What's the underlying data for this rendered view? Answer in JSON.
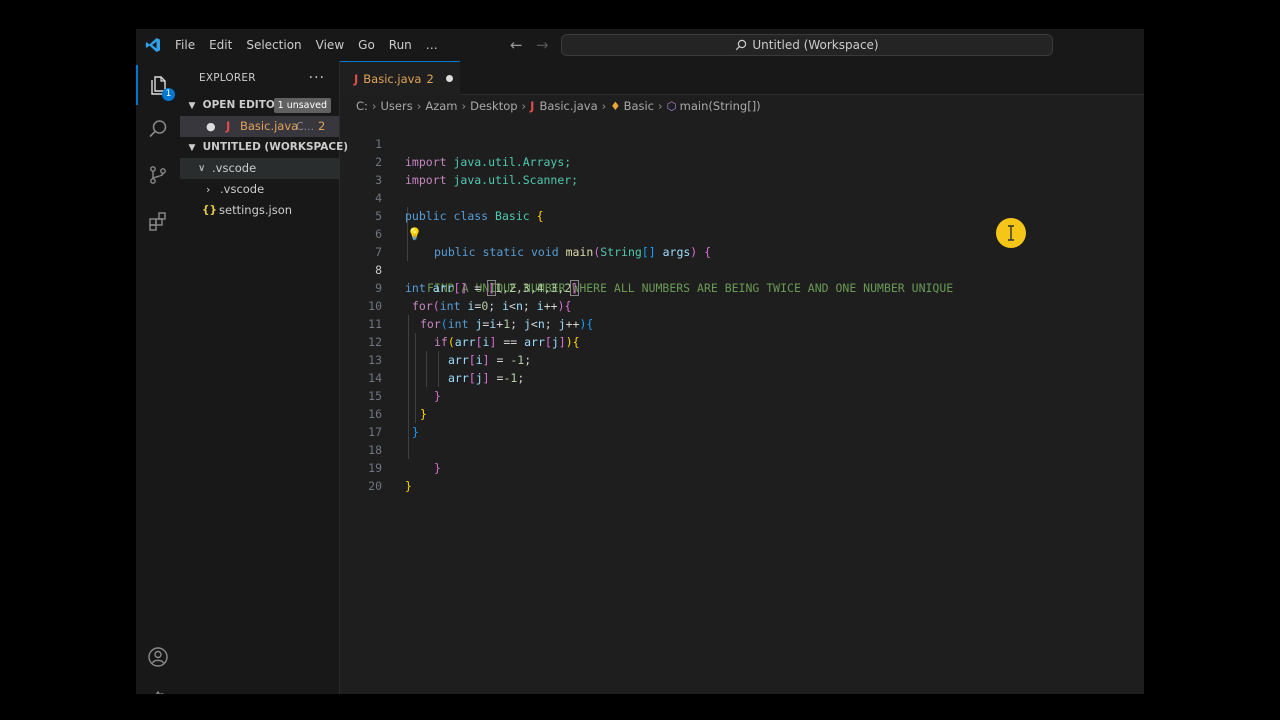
{
  "titlebar": {
    "menu": [
      "File",
      "Edit",
      "Selection",
      "View",
      "Go",
      "Run",
      "…"
    ],
    "search_text": "Untitled (Workspace)"
  },
  "activity": {
    "explorer_badge": "1"
  },
  "sidebar": {
    "title": "EXPLORER",
    "more": "···",
    "open_editors": {
      "label": "OPEN EDITORS",
      "pill": "1 unsaved"
    },
    "open_file": {
      "icon": "J",
      "name": "Basic.java",
      "detail": "C...",
      "count": "2"
    },
    "workspace": {
      "label": "UNTITLED (WORKSPACE)"
    },
    "tree": [
      {
        "name": ".vscode"
      },
      {
        "name": ".vscode"
      },
      {
        "icon": "{}",
        "name": "settings.json"
      }
    ]
  },
  "tab": {
    "icon": "J",
    "name": "Basic.java",
    "count": "2"
  },
  "breadcrumbs": {
    "items": [
      "C:",
      "Users",
      "Azam",
      "Desktop",
      "Basic.java",
      "Basic",
      "main(String[])"
    ]
  },
  "editor": {
    "line_numbers": [
      "1",
      "2",
      "3",
      "4",
      "5",
      "6",
      "7",
      "8",
      "9",
      "10",
      "11",
      "12",
      "13",
      "14",
      "15",
      "16",
      "17",
      "18",
      "19",
      "20"
    ],
    "current_line": "8",
    "code": {
      "l1": [
        "import",
        "java.util.Arrays;"
      ],
      "l2": [
        "import",
        "java.util.Scanner;"
      ],
      "l4": [
        "public",
        "class",
        "Basic",
        "{"
      ],
      "l6": [
        "public",
        "static",
        "void",
        "main",
        "(",
        "String",
        "[]",
        "args",
        ")",
        "{"
      ],
      "l7": "FIND A UNIQUE NUMBER WHERE ALL NUMBERS ARE BEING TWICE AND ONE NUMBER UNIQUE",
      "l8": [
        "int",
        "arr",
        "[]",
        "=",
        "[",
        "1,2,3,4,3,2",
        "]"
      ],
      "l9": [
        "for",
        "(",
        "int",
        "i",
        "=",
        "0",
        "; ",
        "i",
        "<",
        "n",
        "; ",
        "i",
        "++",
        ")",
        "{"
      ],
      "l10": [
        "for",
        "(",
        "int",
        "j",
        "=",
        "i",
        "+",
        "1",
        "; ",
        "j",
        "<",
        "n",
        "; ",
        "j",
        "++",
        ")",
        "{"
      ],
      "l11": [
        "if",
        "(",
        "arr",
        "[",
        "i",
        "]",
        " == ",
        "arr",
        "[",
        "j",
        "]",
        ")",
        "{"
      ],
      "l12": [
        "arr",
        "[",
        "i",
        "]",
        " = ",
        "-1",
        ";"
      ],
      "l13": [
        "arr",
        "[",
        "j",
        "]",
        " =",
        "-1",
        ";"
      ],
      "l14": "}",
      "l15": "}",
      "l16": "}",
      "l18": "}",
      "l19": "}"
    }
  }
}
